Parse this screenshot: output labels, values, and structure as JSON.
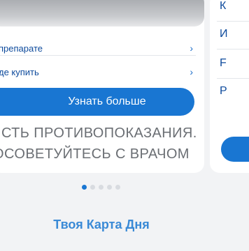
{
  "card": {
    "links": [
      {
        "label": "препарате"
      },
      {
        "label": "де купить"
      }
    ],
    "learn_more_label": "Узнать больше",
    "warning_lines": [
      "СТЬ ПРОТИВОПОКАЗАНИЯ.",
      "ОСОВЕТУЙТЕСЬ С ВРАЧОМ"
    ]
  },
  "next_card": {
    "letters": [
      "К",
      "И",
      "F",
      "Р"
    ]
  },
  "carousel": {
    "dot_count": 5,
    "active_index": 0
  },
  "section": {
    "title": "Твоя Карта Дня"
  },
  "colors": {
    "accent": "#1976d2",
    "link": "#0d4a9c",
    "muted_text": "#6b6f74"
  }
}
